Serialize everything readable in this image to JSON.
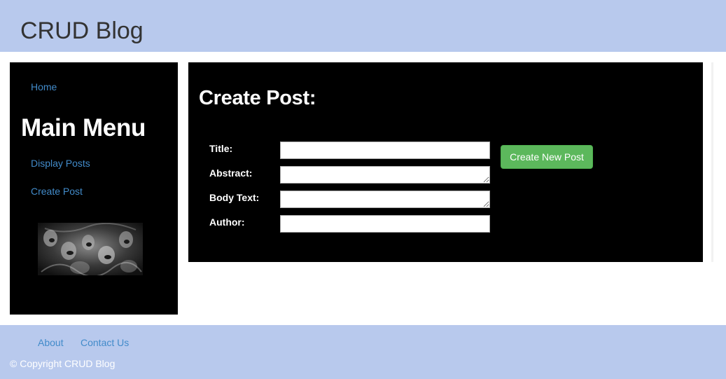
{
  "header": {
    "title": "CRUD Blog"
  },
  "sidebar": {
    "home_link": "Home",
    "heading": "Main Menu",
    "links": [
      {
        "label": "Display Posts"
      },
      {
        "label": "Create Post"
      }
    ]
  },
  "form": {
    "heading": "Create Post:",
    "fields": [
      {
        "label": "Title:",
        "value": ""
      },
      {
        "label": "Abstract:",
        "value": ""
      },
      {
        "label": "Body Text:",
        "value": ""
      },
      {
        "label": "Author:",
        "value": ""
      }
    ],
    "submit_label": "Create New Post"
  },
  "footer": {
    "links": [
      {
        "label": "About"
      },
      {
        "label": "Contact Us"
      }
    ],
    "copyright": "© Copyright CRUD Blog"
  },
  "colors": {
    "header_bg": "#b8c9ed",
    "link": "#428bca",
    "panel_bg": "#000000",
    "button": "#5cb85c"
  }
}
